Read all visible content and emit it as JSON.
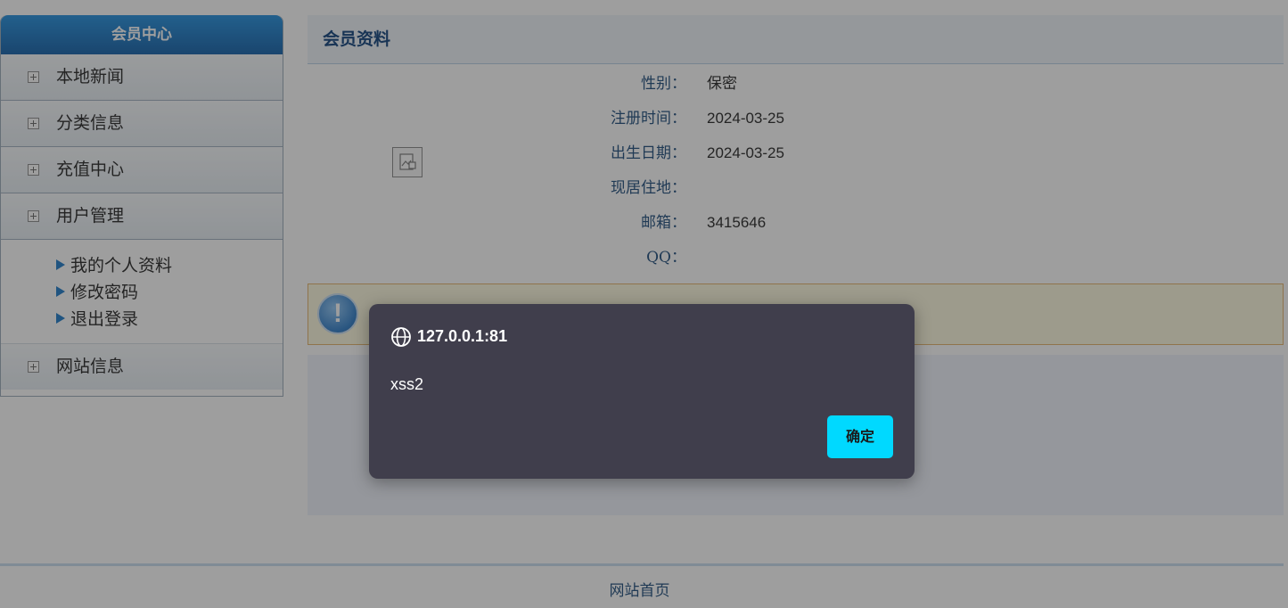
{
  "sidebar": {
    "title": "会员中心",
    "items": [
      {
        "label": "本地新闻"
      },
      {
        "label": "分类信息"
      },
      {
        "label": "充值中心"
      },
      {
        "label": "用户管理"
      }
    ],
    "submenu": [
      {
        "label": "我的个人资料"
      },
      {
        "label": "修改密码"
      },
      {
        "label": "退出登录"
      }
    ],
    "last_item": {
      "label": "网站信息"
    }
  },
  "main": {
    "title": "会员资料",
    "avatar_icon": "broken-image-icon",
    "fields": [
      {
        "key": "性别：",
        "value": "保密"
      },
      {
        "key": "注册时间：",
        "value": "2024-03-25"
      },
      {
        "key": "出生日期：",
        "value": "2024-03-25"
      },
      {
        "key": "现居住地：",
        "value": ""
      },
      {
        "key": "邮箱：",
        "value": "3415646"
      },
      {
        "key": "QQ：",
        "value": ""
      }
    ],
    "notice_icon": "info-exclamation-icon"
  },
  "footer": {
    "link": "网站首页"
  },
  "dialog": {
    "icon": "globe-icon",
    "title": "127.0.0.1:81",
    "message": "xss2",
    "ok_label": "确定",
    "ok_color": "#00d9ff",
    "bg_color": "#403e4c"
  }
}
